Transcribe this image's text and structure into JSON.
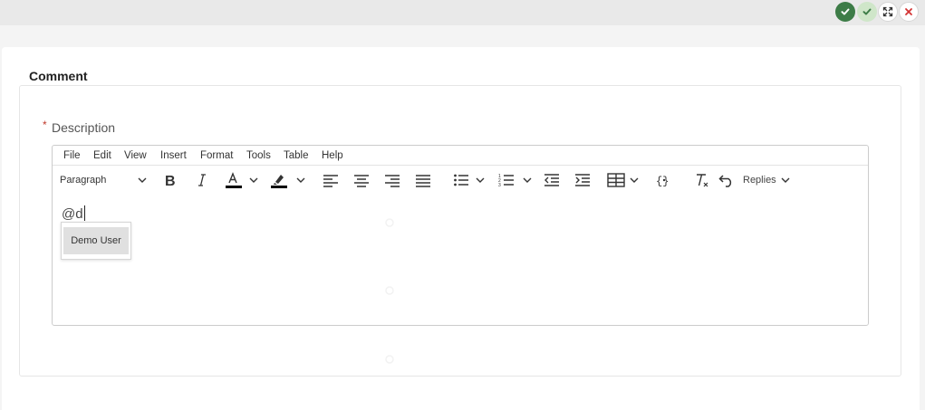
{
  "window_controls": {
    "buttons": [
      {
        "name": "save-and-close",
        "icon": "check-badge-icon",
        "color": "#3d7c47"
      },
      {
        "name": "save",
        "icon": "check-icon",
        "color": "#cfe6c9"
      },
      {
        "name": "expand",
        "icon": "expand-icon",
        "color": "#ffffff"
      },
      {
        "name": "close",
        "icon": "close-icon",
        "color": "#d33333"
      }
    ]
  },
  "section": {
    "title": "Comment"
  },
  "field": {
    "required_marker": "*",
    "label": "Description"
  },
  "editor": {
    "menu": [
      "File",
      "Edit",
      "View",
      "Insert",
      "Format",
      "Tools",
      "Table",
      "Help"
    ],
    "toolbar": {
      "block_format": "Paragraph",
      "replies_label": "Replies",
      "tools": [
        "bold-icon",
        "italic-icon",
        "text-color-icon",
        "highlight-color-icon",
        "align-left-icon",
        "align-center-icon",
        "align-right-icon",
        "align-justify-icon",
        "bullet-list-icon",
        "numbered-list-icon",
        "outdent-icon",
        "indent-icon",
        "table-icon",
        "code-sample-icon",
        "clear-formatting-icon",
        "undo-icon"
      ],
      "text_color": "#000000",
      "highlight_color": "#000000"
    },
    "content_value": "@d"
  },
  "mention_popup": {
    "items": [
      "Demo User"
    ]
  }
}
